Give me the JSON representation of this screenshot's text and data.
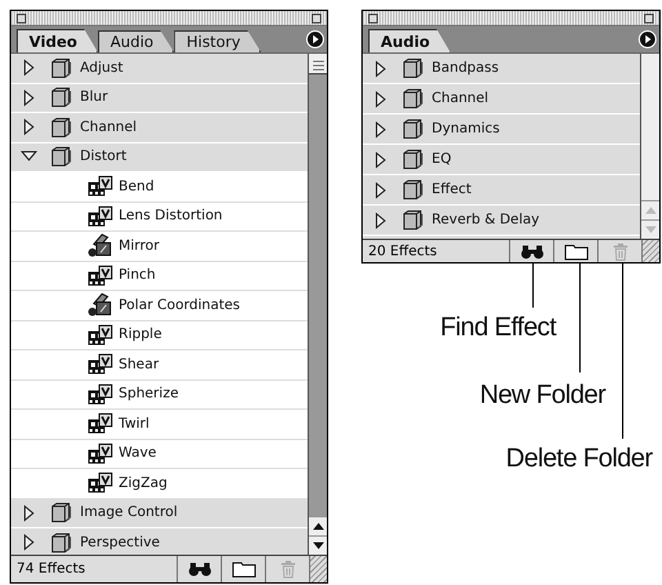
{
  "panels": [
    {
      "tabs": [
        {
          "label": "Video",
          "selected": true
        },
        {
          "label": "Audio",
          "selected": false
        },
        {
          "label": "History",
          "selected": false
        }
      ],
      "scrollbar": {
        "kind": "active"
      },
      "items": [
        {
          "label": "Adjust",
          "expanded": false
        },
        {
          "label": "Blur",
          "expanded": false
        },
        {
          "label": "Channel",
          "expanded": false
        },
        {
          "label": "Distort",
          "expanded": true,
          "children": [
            {
              "label": "Bend",
              "kind": "film"
            },
            {
              "label": "Lens Distortion",
              "kind": "film"
            },
            {
              "label": "Mirror",
              "kind": "plugin"
            },
            {
              "label": "Pinch",
              "kind": "film"
            },
            {
              "label": "Polar Coordinates",
              "kind": "plugin"
            },
            {
              "label": "Ripple",
              "kind": "film"
            },
            {
              "label": "Shear",
              "kind": "film"
            },
            {
              "label": "Spherize",
              "kind": "film"
            },
            {
              "label": "Twirl",
              "kind": "film"
            },
            {
              "label": "Wave",
              "kind": "film"
            },
            {
              "label": "ZigZag",
              "kind": "film"
            }
          ]
        },
        {
          "label": "Image Control",
          "expanded": false
        },
        {
          "label": "Perspective",
          "expanded": false
        }
      ],
      "status": "74 Effects",
      "tools": [
        {
          "kind": "find",
          "disabled": false
        },
        {
          "kind": "folder",
          "disabled": false
        },
        {
          "kind": "trash",
          "disabled": true
        }
      ]
    },
    {
      "tabs": [
        {
          "label": "Audio",
          "selected": true
        }
      ],
      "scrollbar": {
        "kind": "inactive"
      },
      "items": [
        {
          "label": "Bandpass",
          "expanded": false
        },
        {
          "label": "Channel",
          "expanded": false
        },
        {
          "label": "Dynamics",
          "expanded": false
        },
        {
          "label": "EQ",
          "expanded": false
        },
        {
          "label": "Effect",
          "expanded": false
        },
        {
          "label": "Reverb & Delay",
          "expanded": false
        }
      ],
      "status": "20 Effects",
      "tools": [
        {
          "kind": "find",
          "disabled": false
        },
        {
          "kind": "folder",
          "disabled": false
        },
        {
          "kind": "trash",
          "disabled": true
        }
      ]
    }
  ],
  "callouts": [
    {
      "label": "Find Effect"
    },
    {
      "label": "New Folder"
    },
    {
      "label": "Delete Folder"
    }
  ]
}
